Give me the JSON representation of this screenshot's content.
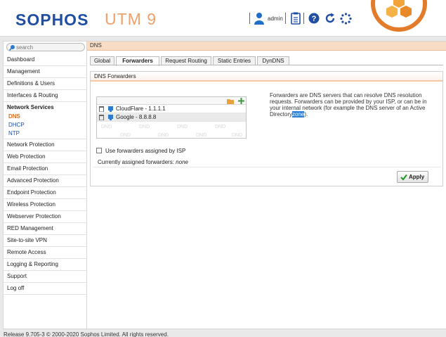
{
  "header": {
    "brand": "SOPHOS",
    "product": "UTM 9",
    "user": "admin"
  },
  "colors": {
    "brand_blue": "#1f4ea3",
    "accent_orange": "#e37c2a",
    "selected_nav": "#d96b1e",
    "apply_green": "#2d9a2d"
  },
  "search": {
    "placeholder": "search"
  },
  "nav": {
    "items_top": [
      "Dashboard",
      "Management",
      "Definitions & Users",
      "Interfaces & Routing"
    ],
    "active": "Network Services",
    "sub": [
      "DNS",
      "DHCP",
      "NTP"
    ],
    "items_bottom": [
      "Network Protection",
      "Web Protection",
      "Email Protection",
      "Advanced Protection",
      "Endpoint Protection",
      "Wireless Protection",
      "Webserver Protection",
      "RED Management",
      "Site-to-site VPN",
      "Remote Access",
      "Logging & Reporting",
      "Support",
      "Log off"
    ]
  },
  "page": {
    "title": "DNS"
  },
  "tabs": [
    "Global",
    "Forwarders",
    "Request Routing",
    "Static Entries",
    "DynDNS"
  ],
  "panel": {
    "title": "DNS Forwarders",
    "forwarders": [
      "CloudFlare - 1.1.1.1",
      "Google - 8.8.8.8"
    ],
    "dnd_label": "DND",
    "description_before": "Forwarders are DNS servers that can resolve DNS resolution requests. Forwarders can be provided by your ISP, or can be in your internal network (for example the DNS server of an Active Directory",
    "description_highlight": "zone",
    "description_after": ").",
    "isp_checkbox_label": "Use forwarders assigned by ISP",
    "assigned_label": "Currently assigned forwarders:",
    "assigned_value": "none",
    "apply_label": "Apply"
  },
  "footer": {
    "text": "Release 9.705-3  © 2000-2020 Sophos Limited. All rights reserved."
  }
}
